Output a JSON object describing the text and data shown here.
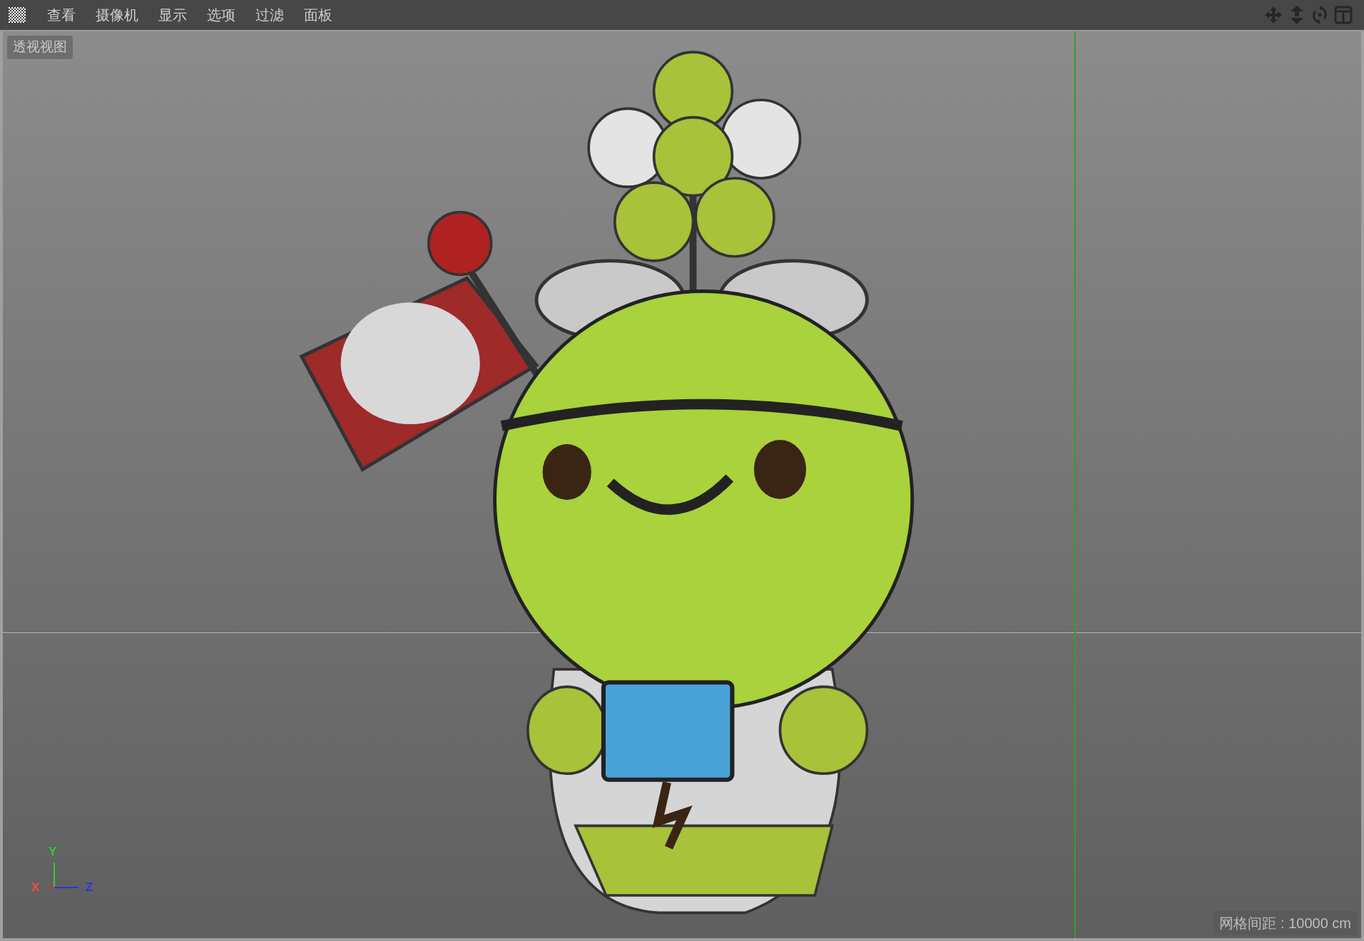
{
  "menu_bar": {
    "items": [
      "查看",
      "摄像机",
      "显示",
      "选项",
      "过滤",
      "面板"
    ]
  },
  "viewport": {
    "title": "透视视图",
    "grid_spacing": "网格间距 : 10000 cm",
    "axes": [
      {
        "label": "Y",
        "color": "#33cc33"
      },
      {
        "label": "X",
        "color": "#ff4a4a"
      },
      {
        "label": "Z",
        "color": "#3333dd"
      }
    ]
  }
}
